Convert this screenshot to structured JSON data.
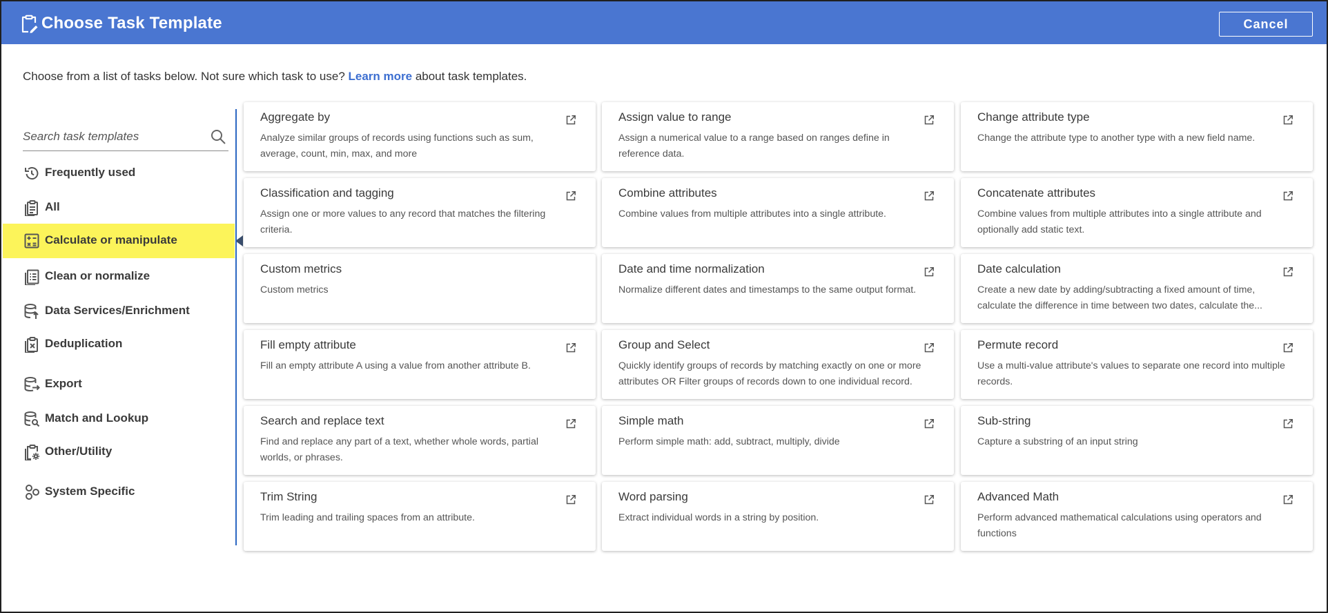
{
  "header": {
    "title": "Choose Task Template",
    "cancel_label": "Cancel",
    "title_icon": "clipboard-edit-icon"
  },
  "intro": {
    "prefix": "Choose from a list of tasks below. Not sure which task to use? ",
    "link": "Learn more",
    "suffix": " about task templates."
  },
  "search": {
    "placeholder": "Search task templates",
    "icon": "search-icon"
  },
  "sidebar": {
    "active_index": 2,
    "items": [
      {
        "label": "Frequently used",
        "icon": "history-icon"
      },
      {
        "label": "All",
        "icon": "clipboard-list-icon"
      },
      {
        "label": "Calculate or manipulate",
        "icon": "calculator-icon"
      },
      {
        "label": "Clean or normalize",
        "icon": "list-clean-icon"
      },
      {
        "label": "Data Services/Enrichment",
        "icon": "database-upload-icon"
      },
      {
        "label": "Deduplication",
        "icon": "clipboard-remove-icon"
      },
      {
        "label": "Export",
        "icon": "database-export-icon"
      },
      {
        "label": "Match and Lookup",
        "icon": "database-search-icon"
      },
      {
        "label": "Other/Utility",
        "icon": "clipboard-gear-icon"
      },
      {
        "label": "System Specific",
        "icon": "shapes-icon"
      }
    ]
  },
  "templates": [
    {
      "title": "Aggregate by",
      "desc": "Analyze similar groups of records using functions such as sum, average, count, min, max, and more",
      "link": true
    },
    {
      "title": "Assign value to range",
      "desc": "Assign a numerical value to a range based on ranges define in reference data.",
      "link": true
    },
    {
      "title": "Change attribute type",
      "desc": "Change the attribute type to another type with a new field name.",
      "link": true
    },
    {
      "title": "Classification and tagging",
      "desc": "Assign one or more values to any record that matches the filtering criteria.",
      "link": true
    },
    {
      "title": "Combine attributes",
      "desc": "Combine values from multiple attributes into a single attribute.",
      "link": true
    },
    {
      "title": "Concatenate attributes",
      "desc": "Combine values from multiple attributes into a single attribute and optionally add static text.",
      "link": true
    },
    {
      "title": "Custom metrics",
      "desc": "Custom metrics",
      "link": false
    },
    {
      "title": "Date and time normalization",
      "desc": "Normalize different dates and timestamps to the same output format.",
      "link": true
    },
    {
      "title": "Date calculation",
      "desc": "Create a new date by adding/subtracting a fixed amount of time, calculate the difference in time between two dates, calculate the...",
      "link": true
    },
    {
      "title": "Fill empty attribute",
      "desc": "Fill an empty attribute A using a value from another attribute B.",
      "link": true
    },
    {
      "title": "Group and Select",
      "desc": "Quickly identify groups of records by matching exactly on one or more attributes OR Filter groups of records down to one individual record.",
      "link": true
    },
    {
      "title": "Permute record",
      "desc": "Use a multi-value attribute's values to separate one record into multiple records.",
      "link": true
    },
    {
      "title": "Search and replace text",
      "desc": "Find and replace any part of a text, whether whole words, partial worlds, or phrases.",
      "link": true
    },
    {
      "title": "Simple math",
      "desc": "Perform simple math: add, subtract, multiply, divide",
      "link": true
    },
    {
      "title": "Sub-string",
      "desc": "Capture a substring of an input string",
      "link": true
    },
    {
      "title": "Trim String",
      "desc": "Trim leading and trailing spaces from an attribute.",
      "link": true
    },
    {
      "title": "Word parsing",
      "desc": "Extract individual words in a string by position.",
      "link": true
    },
    {
      "title": "Advanced Math",
      "desc": "Perform advanced mathematical calculations using operators and functions",
      "link": true
    }
  ]
}
